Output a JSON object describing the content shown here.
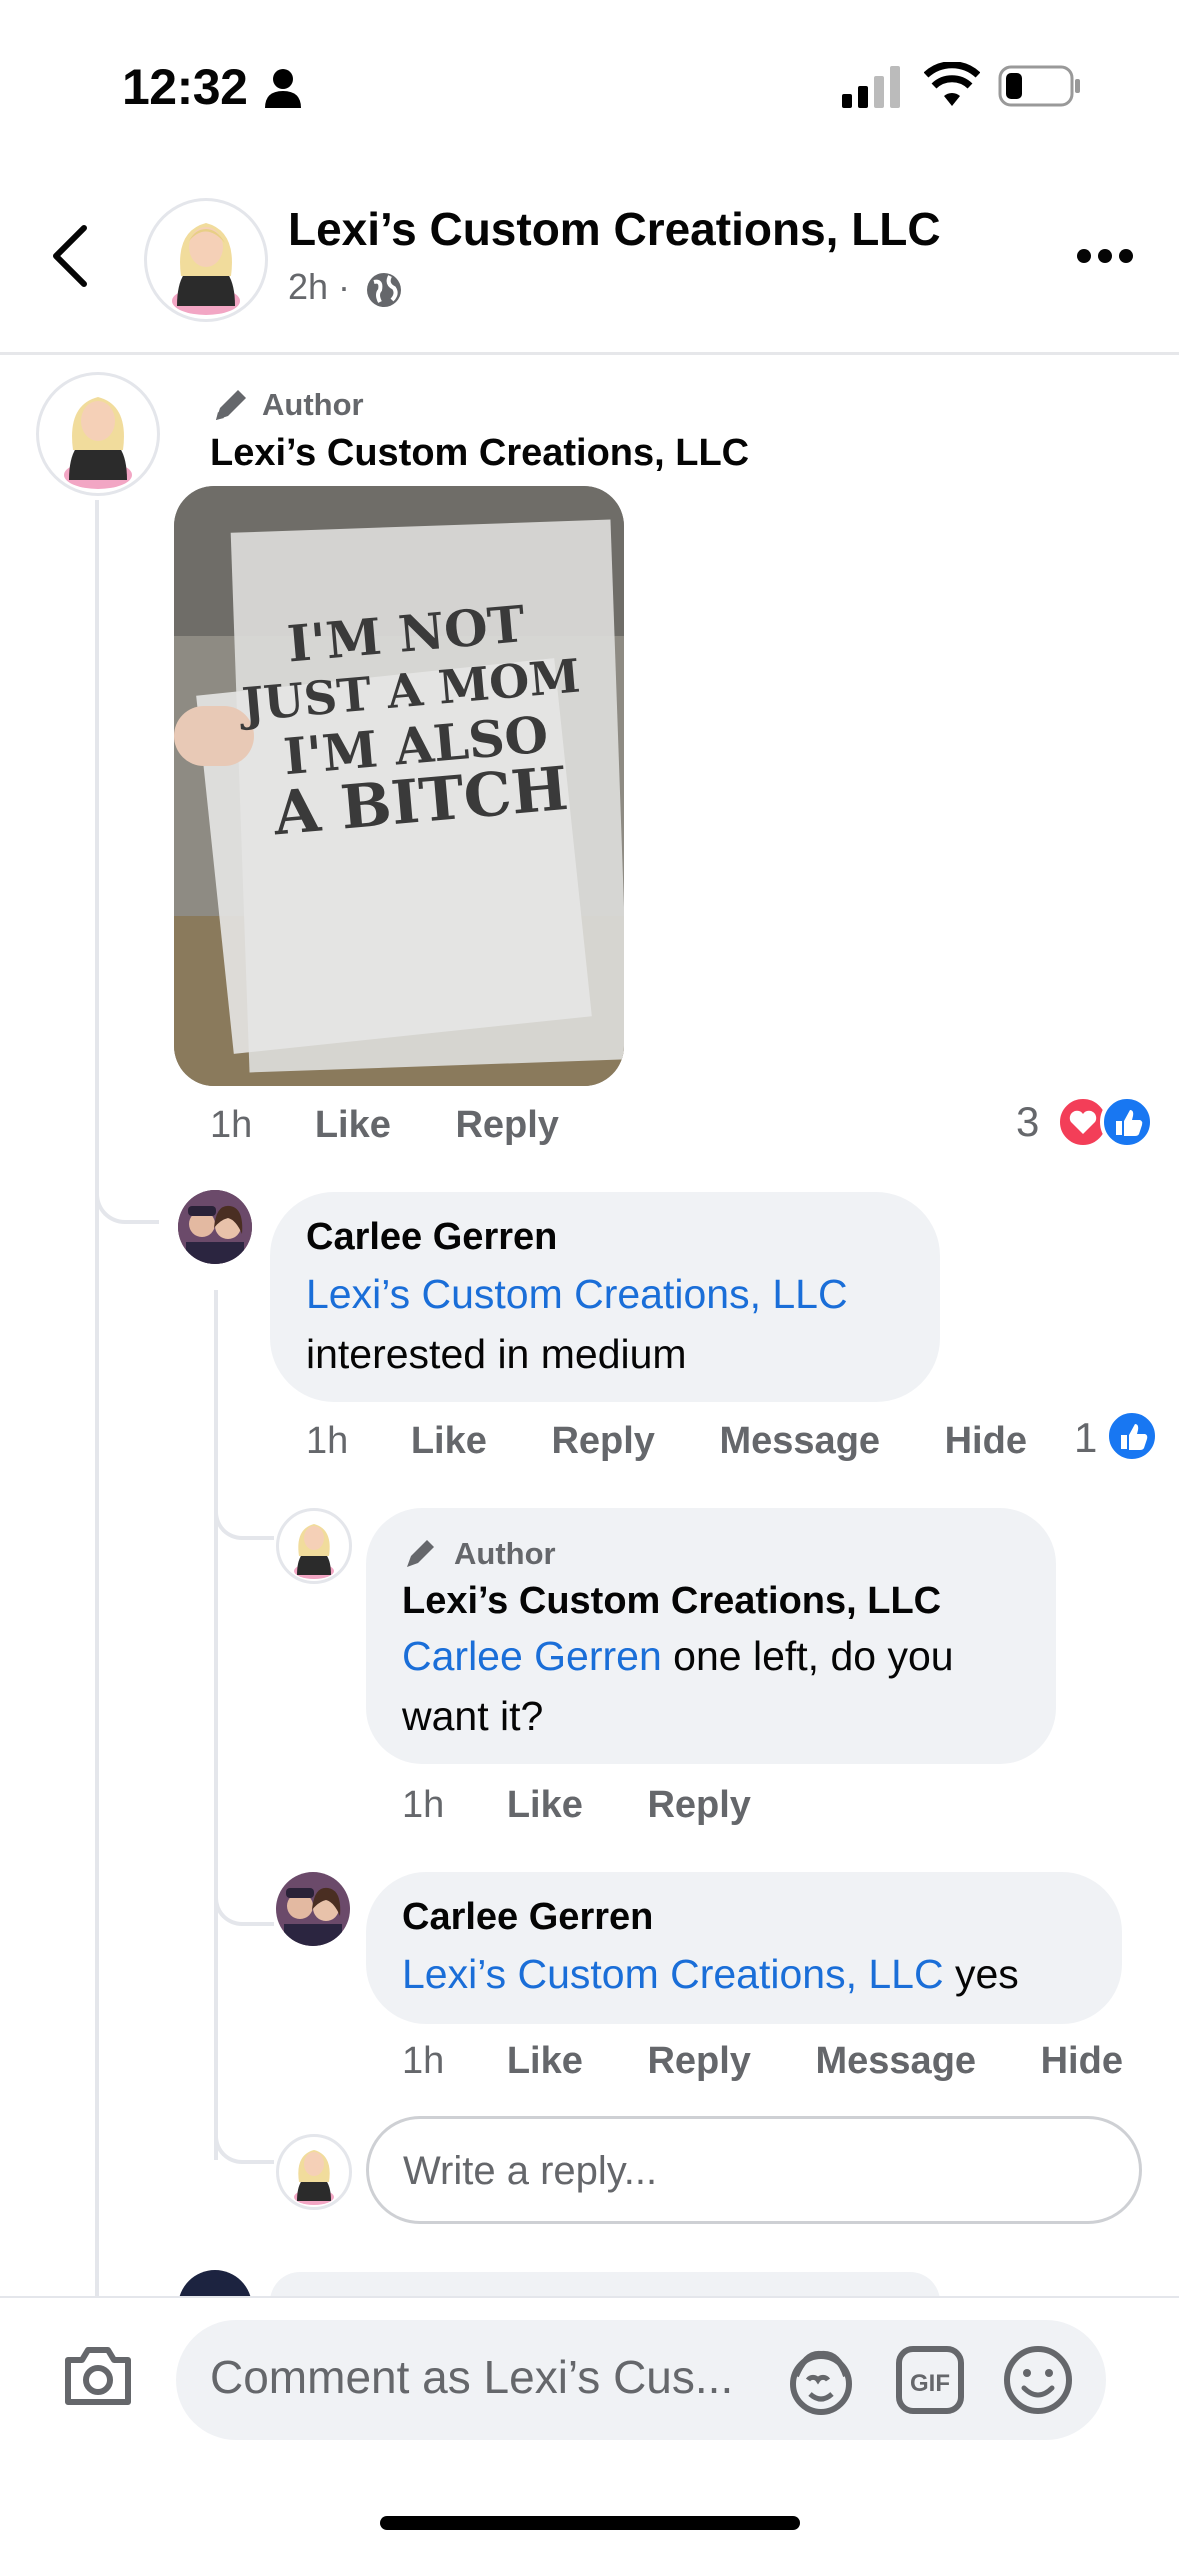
{
  "status_bar": {
    "time": "12:32"
  },
  "header": {
    "page_name": "Lexi’s Custom Creations, LLC",
    "time_ago": "2h ·"
  },
  "post_comment": {
    "author_tag": "Author",
    "name": "Lexi’s Custom Creations, LLC",
    "image_text": [
      "I'M NOT",
      "JUST A MOM",
      "I'M ALSO",
      "A BITCH"
    ],
    "time": "1h",
    "like": "Like",
    "reply": "Reply",
    "reaction_count": "3"
  },
  "reply_1": {
    "name": "Carlee Gerren",
    "mention": "Lexi’s Custom Creations, LLC",
    "text": "interested in medium",
    "time": "1h",
    "like": "Like",
    "reply": "Reply",
    "message": "Message",
    "hide": "Hide",
    "reaction_count": "1"
  },
  "reply_2": {
    "author_tag": "Author",
    "name": "Lexi’s Custom Creations, LLC",
    "mention": "Carlee Gerren",
    "text": " one left, do you want it?",
    "time": "1h",
    "like": "Like",
    "reply": "Reply"
  },
  "reply_3": {
    "name": "Carlee Gerren",
    "mention": "Lexi’s Custom Creations, LLC",
    "text": " yes",
    "time": "1h",
    "like": "Like",
    "reply": "Reply",
    "message": "Message",
    "hide": "Hide"
  },
  "reply_input": {
    "placeholder": "Write a reply..."
  },
  "comment_bar": {
    "placeholder": "Comment as Lexi’s Cus..."
  },
  "colors": {
    "link": "#1a6ed8",
    "like_blue": "#1877f2",
    "love_red": "#f33e58"
  }
}
